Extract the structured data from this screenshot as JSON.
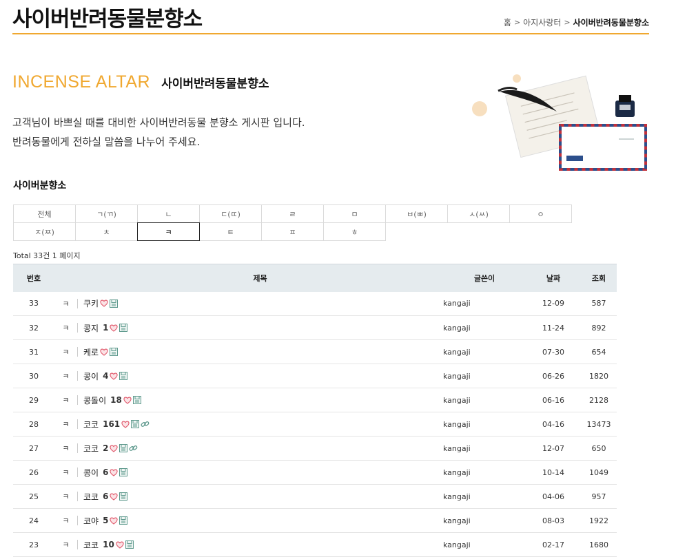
{
  "header": {
    "title": "사이버반려동물분향소",
    "breadcrumb": [
      {
        "label": "홈"
      },
      {
        "label": "아지사랑터"
      },
      {
        "label": "사이버반려동물분향소"
      }
    ]
  },
  "intro": {
    "en_title": "INCENSE ALTAR",
    "ko_title": "사이버반려동물분향소",
    "line1": "고객님이 바쁘실 때를 대비한 사이버반려동물 분향소 게시판 입니다.",
    "line2": "반려동물에게 전하실 말씀을 나누어 주세요."
  },
  "section_title": "사이버분향소",
  "filters": {
    "row1": [
      "전체",
      "ㄱ(ㄲ)",
      "ㄴ",
      "ㄷ(ㄸ)",
      "ㄹ",
      "ㅁ",
      "ㅂ(ㅃ)",
      "ㅅ(ㅆ)",
      "ㅇ"
    ],
    "row2": [
      "ㅈ(ㅉ)",
      "ㅊ",
      "ㅋ",
      "ㅌ",
      "ㅍ",
      "ㅎ"
    ],
    "active": "ㅋ"
  },
  "total": "Total 33건 1 페이지",
  "table": {
    "headers": {
      "no": "번호",
      "title": "제목",
      "writer": "글쓴이",
      "date": "날짜",
      "hits": "조회"
    },
    "rows": [
      {
        "no": "33",
        "cat": "ㅋ",
        "subject": "쿠키",
        "comments": "",
        "link": false,
        "writer": "kangaji",
        "date": "12-09",
        "hits": "587"
      },
      {
        "no": "32",
        "cat": "ㅋ",
        "subject": "콩지",
        "comments": "1",
        "link": false,
        "writer": "kangaji",
        "date": "11-24",
        "hits": "892"
      },
      {
        "no": "31",
        "cat": "ㅋ",
        "subject": "케로",
        "comments": "",
        "link": false,
        "writer": "kangaji",
        "date": "07-30",
        "hits": "654"
      },
      {
        "no": "30",
        "cat": "ㅋ",
        "subject": "콩이",
        "comments": "4",
        "link": false,
        "writer": "kangaji",
        "date": "06-26",
        "hits": "1820"
      },
      {
        "no": "29",
        "cat": "ㅋ",
        "subject": "콩돌이",
        "comments": "18",
        "link": false,
        "writer": "kangaji",
        "date": "06-16",
        "hits": "2128"
      },
      {
        "no": "28",
        "cat": "ㅋ",
        "subject": "코코",
        "comments": "161",
        "link": true,
        "writer": "kangaji",
        "date": "04-16",
        "hits": "13473"
      },
      {
        "no": "27",
        "cat": "ㅋ",
        "subject": "코코",
        "comments": "2",
        "link": true,
        "writer": "kangaji",
        "date": "12-07",
        "hits": "650"
      },
      {
        "no": "26",
        "cat": "ㅋ",
        "subject": "콩이",
        "comments": "6",
        "link": false,
        "writer": "kangaji",
        "date": "10-14",
        "hits": "1049"
      },
      {
        "no": "25",
        "cat": "ㅋ",
        "subject": "코코",
        "comments": "6",
        "link": false,
        "writer": "kangaji",
        "date": "04-06",
        "hits": "957"
      },
      {
        "no": "24",
        "cat": "ㅋ",
        "subject": "코야",
        "comments": "5",
        "link": false,
        "writer": "kangaji",
        "date": "08-03",
        "hits": "1922"
      },
      {
        "no": "23",
        "cat": "ㅋ",
        "subject": "코코",
        "comments": "10",
        "link": false,
        "writer": "kangaji",
        "date": "02-17",
        "hits": "1680"
      }
    ]
  },
  "icons": {
    "heart": "heart-icon",
    "file": "file-icon",
    "link": "link-icon"
  },
  "colors": {
    "accent": "#f0a830",
    "table_header_bg": "#e5ebee",
    "heart": "#e0576a",
    "file": "#5f9a8e"
  }
}
